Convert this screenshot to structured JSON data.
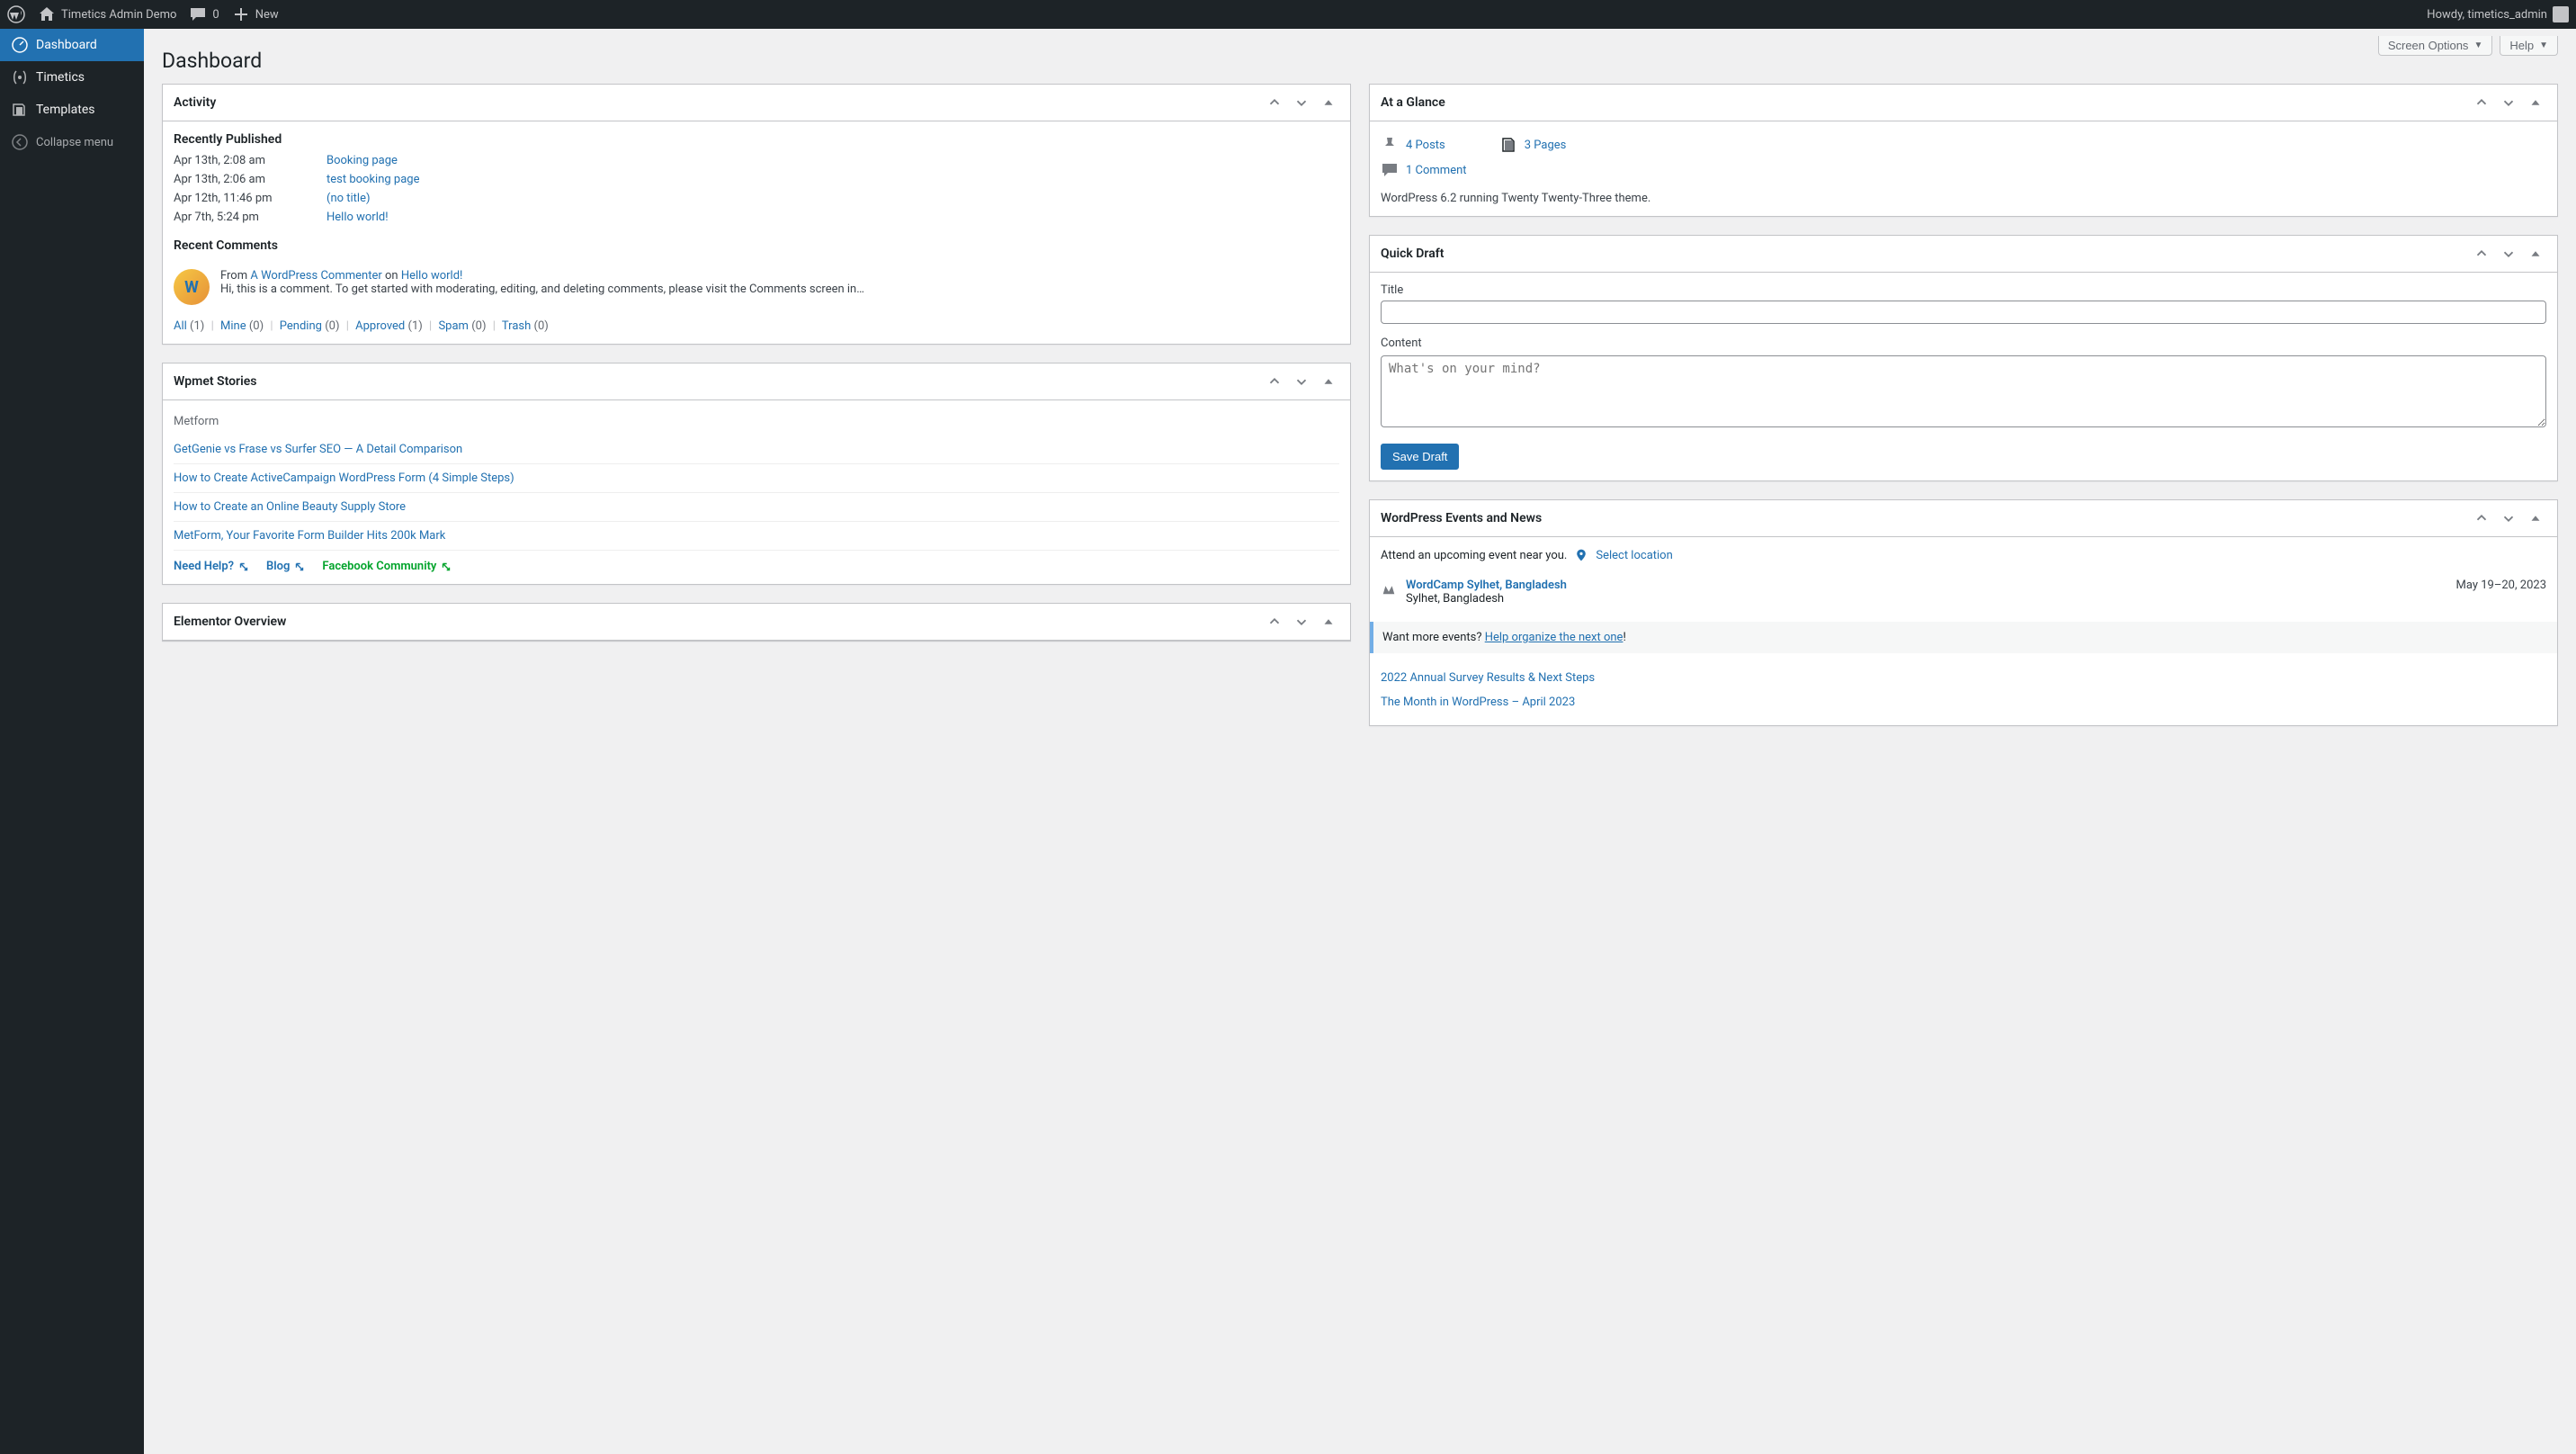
{
  "adminbar": {
    "site_name": "Timetics Admin Demo",
    "comments_count": "0",
    "new_label": "New",
    "howdy": "Howdy, timetics_admin"
  },
  "sidebar": {
    "items": [
      {
        "label": "Dashboard",
        "active": true
      },
      {
        "label": "Timetics"
      },
      {
        "label": "Templates"
      },
      {
        "label": "Collapse menu"
      }
    ]
  },
  "top_buttons": {
    "screen_options": "Screen Options",
    "help": "Help"
  },
  "page_title": "Dashboard",
  "activity": {
    "title": "Activity",
    "recently_published": "Recently Published",
    "posts": [
      {
        "date": "Apr 13th, 2:08 am",
        "title": "Booking page"
      },
      {
        "date": "Apr 13th, 2:06 am",
        "title": "test booking page"
      },
      {
        "date": "Apr 12th, 11:46 pm",
        "title": "(no title)"
      },
      {
        "date": "Apr 7th, 5:24 pm",
        "title": "Hello world!"
      }
    ],
    "recent_comments": "Recent Comments",
    "comment": {
      "from": "From",
      "author": "A WordPress Commenter",
      "on": "on",
      "post": "Hello world!",
      "text": "Hi, this is a comment. To get started with moderating, editing, and deleting comments, please visit the Comments screen in…"
    },
    "filters": {
      "all": {
        "label": "All",
        "count": "(1)"
      },
      "mine": {
        "label": "Mine",
        "count": "(0)"
      },
      "pending": {
        "label": "Pending",
        "count": "(0)"
      },
      "approved": {
        "label": "Approved",
        "count": "(1)"
      },
      "spam": {
        "label": "Spam",
        "count": "(0)"
      },
      "trash": {
        "label": "Trash",
        "count": "(0)"
      }
    }
  },
  "wpmet": {
    "title": "Wpmet Stories",
    "category": "Metform",
    "stories": [
      "GetGenie vs Frase vs Surfer SEO — A Detail Comparison",
      "How to Create ActiveCampaign WordPress Form (4 Simple Steps)",
      "How to Create an Online Beauty Supply Store",
      "MetForm, Your Favorite Form Builder Hits 200k Mark"
    ],
    "footer": {
      "need_help": "Need Help?",
      "blog": "Blog",
      "facebook": "Facebook Community"
    }
  },
  "elementor": {
    "title": "Elementor Overview"
  },
  "glance": {
    "title": "At a Glance",
    "posts": "4 Posts",
    "pages": "3 Pages",
    "comments": "1 Comment",
    "version": "WordPress 6.2 running Twenty Twenty-Three theme."
  },
  "quick_draft": {
    "title": "Quick Draft",
    "title_label": "Title",
    "content_label": "Content",
    "content_placeholder": "What's on your mind?",
    "save": "Save Draft"
  },
  "events": {
    "title": "WordPress Events and News",
    "attend": "Attend an upcoming event near you.",
    "select_location": "Select location",
    "event": {
      "name": "WordCamp Sylhet, Bangladesh",
      "location": "Sylhet, Bangladesh",
      "date": "May 19–20, 2023"
    },
    "more_prefix": "Want more events? ",
    "more_link": "Help organize the next one",
    "more_suffix": "!",
    "news": [
      "2022 Annual Survey Results & Next Steps",
      "The Month in WordPress – April 2023"
    ]
  }
}
